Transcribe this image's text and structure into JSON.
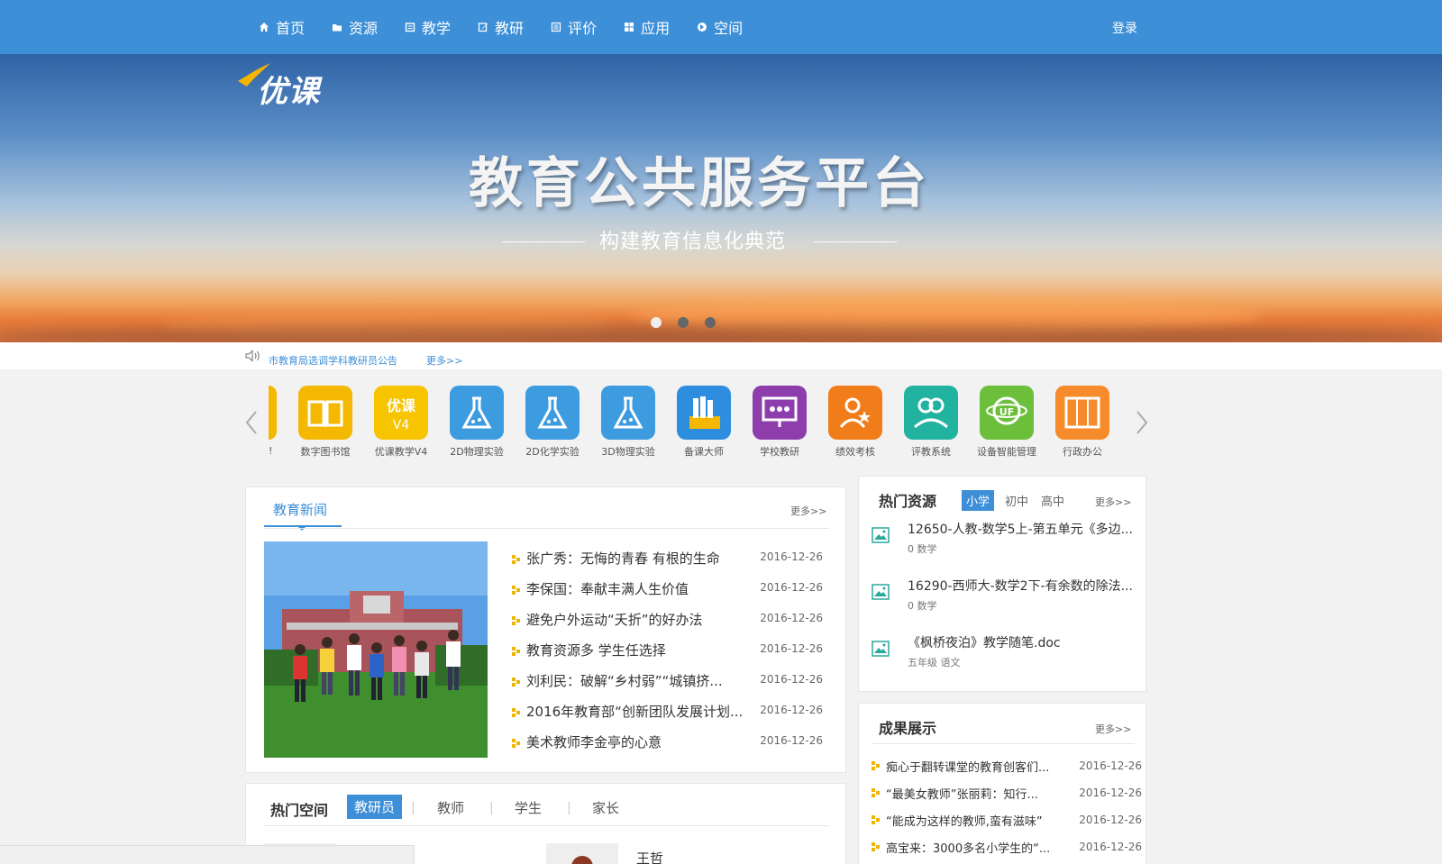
{
  "nav": {
    "items": [
      {
        "label": "首页",
        "icon": "home-icon"
      },
      {
        "label": "资源",
        "icon": "folder-icon"
      },
      {
        "label": "教学",
        "icon": "book-icon"
      },
      {
        "label": "教研",
        "icon": "edit-icon"
      },
      {
        "label": "评价",
        "icon": "list-icon"
      },
      {
        "label": "应用",
        "icon": "grid-icon"
      },
      {
        "label": "空间",
        "icon": "space-icon"
      }
    ],
    "login": "登录"
  },
  "banner": {
    "logo_text": "优课",
    "title": "教育公共服务平台",
    "subtitle": "构建教育信息化典范",
    "slide_count": 3,
    "active_slide": 1
  },
  "notice": {
    "text": "市教育局选调学科教研员公告",
    "more": "更多>>"
  },
  "apps": [
    {
      "label": "数字图书馆",
      "color": "#f5b800",
      "icon": "book-open-icon"
    },
    {
      "label": "优课教学V4",
      "color": "#f7c400",
      "icon": "youke-icon"
    },
    {
      "label": "2D物理实验",
      "color": "#3d9be0",
      "icon": "flask-icon"
    },
    {
      "label": "2D化学实验",
      "color": "#3d9be0",
      "icon": "flask-icon"
    },
    {
      "label": "3D物理实验",
      "color": "#3d9be0",
      "icon": "flask-icon"
    },
    {
      "label": "备课大师",
      "color": "#2f8de0",
      "icon": "books-icon"
    },
    {
      "label": "学校教研",
      "color": "#8e3dad",
      "icon": "presentation-icon"
    },
    {
      "label": "绩效考核",
      "color": "#f07d1a",
      "icon": "star-person-icon"
    },
    {
      "label": "评教系统",
      "color": "#22b3a0",
      "icon": "people-icon"
    },
    {
      "label": "设备智能管理",
      "color": "#6cbf3a",
      "icon": "globe-icon"
    },
    {
      "label": "行政办公",
      "color": "#f58b2a",
      "icon": "cabinet-icon"
    }
  ],
  "news": {
    "tab": "教育新闻",
    "more": "更多>>",
    "items": [
      {
        "title": "张广秀：无悔的青春 有根的生命",
        "date": "2016-12-26"
      },
      {
        "title": "李保国：奉献丰满人生价值",
        "date": "2016-12-26"
      },
      {
        "title": "避免户外运动“夭折”的好办法",
        "date": "2016-12-26"
      },
      {
        "title": "教育资源多 学生任选择",
        "date": "2016-12-26"
      },
      {
        "title": "刘利民：破解“乡村弱”“城镇挤...",
        "date": "2016-12-26"
      },
      {
        "title": "2016年教育部“创新团队发展计划...",
        "date": "2016-12-26"
      },
      {
        "title": "美术教师李金亭的心意",
        "date": "2016-12-26"
      }
    ]
  },
  "hot_resources": {
    "title": "热门资源",
    "tabs": [
      "小学",
      "初中",
      "高中"
    ],
    "more": "更多>>",
    "items": [
      {
        "title": "12650-人教-数学5上-第五单元《多边...",
        "meta": "0 数学"
      },
      {
        "title": "16290-西师大-数学2下-有余数的除法...",
        "meta": "0 数学"
      },
      {
        "title": "《枫桥夜泊》教学随笔.doc",
        "meta": "五年级 语文"
      }
    ]
  },
  "achievements": {
    "title": "成果展示",
    "more": "更多>>",
    "items": [
      {
        "title": "痴心于翻转课堂的教育创客们...",
        "date": "2016-12-26"
      },
      {
        "title": "“最美女教师”张丽莉：知行...",
        "date": "2016-12-26"
      },
      {
        "title": "“能成为这样的教师,蛮有滋味”",
        "date": "2016-12-26"
      },
      {
        "title": "高宝来：3000多名小学生的“...",
        "date": "2016-12-26"
      }
    ]
  },
  "hot_space": {
    "title": "热门空间",
    "tabs": [
      "教研员",
      "教师",
      "学生",
      "家长"
    ],
    "person": "王哲"
  }
}
